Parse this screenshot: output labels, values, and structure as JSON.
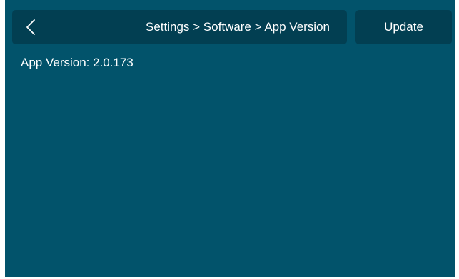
{
  "header": {
    "back_icon": "chevron-left-icon",
    "breadcrumb": "Settings > Software > App Version",
    "update_label": "Update"
  },
  "content": {
    "version_text": "App Version: 2.0.173"
  },
  "colors": {
    "background": "#02536b",
    "bar": "#023f52",
    "text": "#ffffff"
  }
}
